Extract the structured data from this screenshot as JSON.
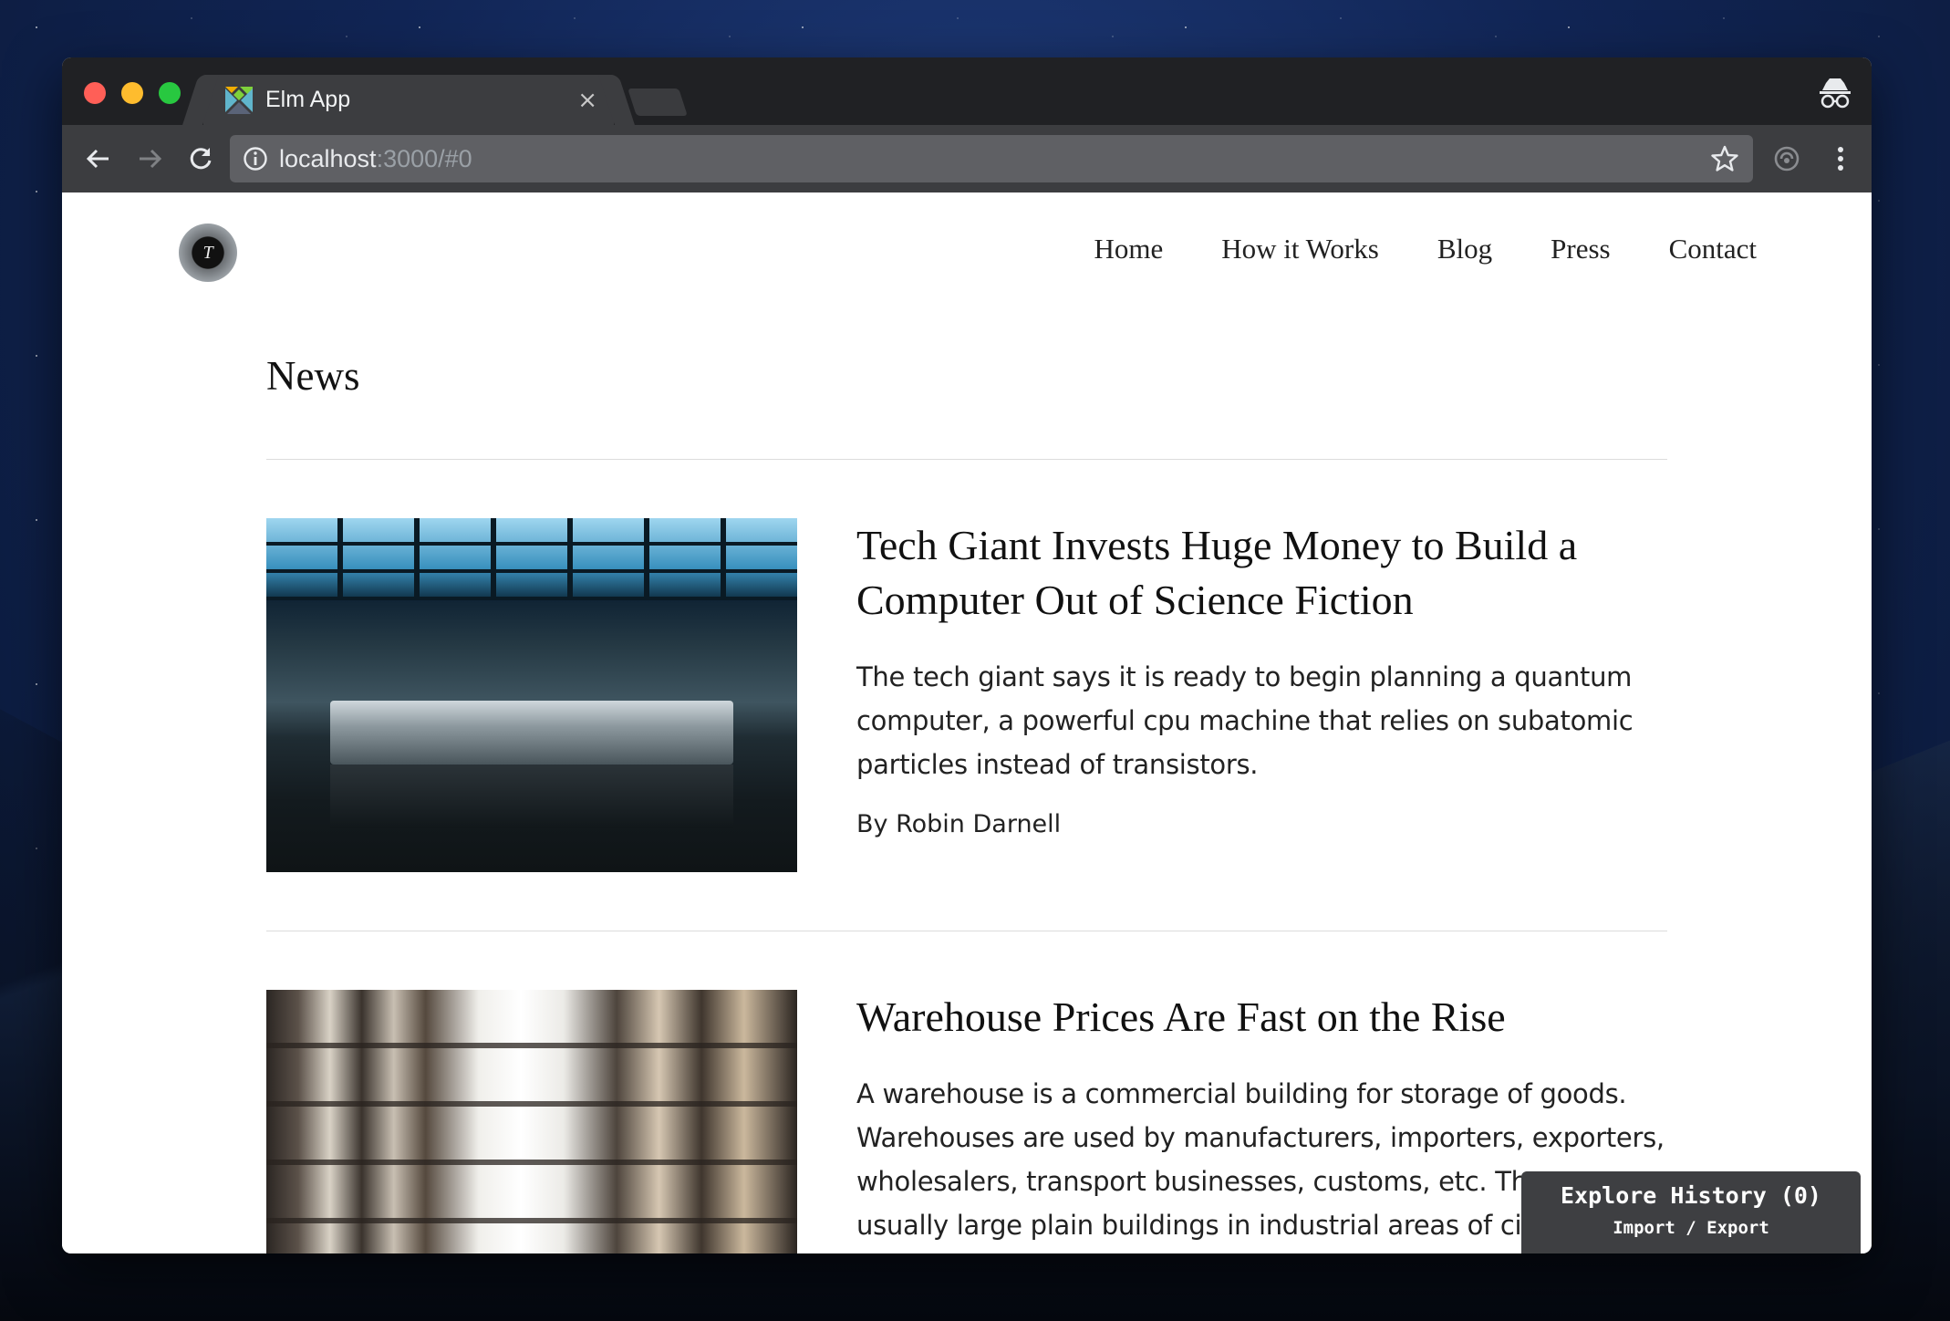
{
  "browser": {
    "tab_title": "Elm App",
    "tab_close": "×",
    "url_host": "localhost",
    "url_rest": ":3000/#0"
  },
  "site": {
    "logo_letter": "T",
    "nav": [
      "Home",
      "How it Works",
      "Blog",
      "Press",
      "Contact"
    ]
  },
  "page": {
    "title": "News",
    "articles": [
      {
        "title": "Tech Giant Invests Huge Money to Build a Computer Out of Science Fiction",
        "summary": "The tech giant says it is ready to begin planning a quantum computer, a powerful cpu machine that relies on subatomic particles instead of transistors.",
        "byline": "By Robin Darnell"
      },
      {
        "title": "Warehouse Prices Are Fast on the Rise",
        "summary": "A warehouse is a commercial building for storage of goods. Warehouses are used by manufacturers, importers, exporters, wholesalers, transport businesses, customs, etc. They are usually large plain buildings in industrial areas of cities, towns and villages."
      }
    ]
  },
  "debugger": {
    "title": "Explore History (0)",
    "links": "Import / Export"
  },
  "colors": {
    "chrome_dark": "#202124",
    "chrome_toolbar": "#3c3d40",
    "omnibox": "#5f6064"
  }
}
